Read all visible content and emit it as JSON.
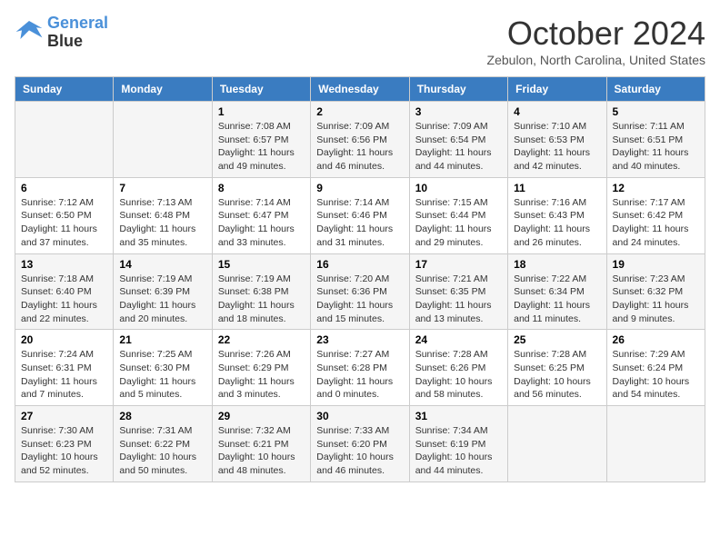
{
  "logo": {
    "line1": "General",
    "line2": "Blue"
  },
  "title": "October 2024",
  "location": "Zebulon, North Carolina, United States",
  "days_of_week": [
    "Sunday",
    "Monday",
    "Tuesday",
    "Wednesday",
    "Thursday",
    "Friday",
    "Saturday"
  ],
  "weeks": [
    [
      {
        "day": "",
        "info": ""
      },
      {
        "day": "",
        "info": ""
      },
      {
        "day": "1",
        "info": "Sunrise: 7:08 AM\nSunset: 6:57 PM\nDaylight: 11 hours and 49 minutes."
      },
      {
        "day": "2",
        "info": "Sunrise: 7:09 AM\nSunset: 6:56 PM\nDaylight: 11 hours and 46 minutes."
      },
      {
        "day": "3",
        "info": "Sunrise: 7:09 AM\nSunset: 6:54 PM\nDaylight: 11 hours and 44 minutes."
      },
      {
        "day": "4",
        "info": "Sunrise: 7:10 AM\nSunset: 6:53 PM\nDaylight: 11 hours and 42 minutes."
      },
      {
        "day": "5",
        "info": "Sunrise: 7:11 AM\nSunset: 6:51 PM\nDaylight: 11 hours and 40 minutes."
      }
    ],
    [
      {
        "day": "6",
        "info": "Sunrise: 7:12 AM\nSunset: 6:50 PM\nDaylight: 11 hours and 37 minutes."
      },
      {
        "day": "7",
        "info": "Sunrise: 7:13 AM\nSunset: 6:48 PM\nDaylight: 11 hours and 35 minutes."
      },
      {
        "day": "8",
        "info": "Sunrise: 7:14 AM\nSunset: 6:47 PM\nDaylight: 11 hours and 33 minutes."
      },
      {
        "day": "9",
        "info": "Sunrise: 7:14 AM\nSunset: 6:46 PM\nDaylight: 11 hours and 31 minutes."
      },
      {
        "day": "10",
        "info": "Sunrise: 7:15 AM\nSunset: 6:44 PM\nDaylight: 11 hours and 29 minutes."
      },
      {
        "day": "11",
        "info": "Sunrise: 7:16 AM\nSunset: 6:43 PM\nDaylight: 11 hours and 26 minutes."
      },
      {
        "day": "12",
        "info": "Sunrise: 7:17 AM\nSunset: 6:42 PM\nDaylight: 11 hours and 24 minutes."
      }
    ],
    [
      {
        "day": "13",
        "info": "Sunrise: 7:18 AM\nSunset: 6:40 PM\nDaylight: 11 hours and 22 minutes."
      },
      {
        "day": "14",
        "info": "Sunrise: 7:19 AM\nSunset: 6:39 PM\nDaylight: 11 hours and 20 minutes."
      },
      {
        "day": "15",
        "info": "Sunrise: 7:19 AM\nSunset: 6:38 PM\nDaylight: 11 hours and 18 minutes."
      },
      {
        "day": "16",
        "info": "Sunrise: 7:20 AM\nSunset: 6:36 PM\nDaylight: 11 hours and 15 minutes."
      },
      {
        "day": "17",
        "info": "Sunrise: 7:21 AM\nSunset: 6:35 PM\nDaylight: 11 hours and 13 minutes."
      },
      {
        "day": "18",
        "info": "Sunrise: 7:22 AM\nSunset: 6:34 PM\nDaylight: 11 hours and 11 minutes."
      },
      {
        "day": "19",
        "info": "Sunrise: 7:23 AM\nSunset: 6:32 PM\nDaylight: 11 hours and 9 minutes."
      }
    ],
    [
      {
        "day": "20",
        "info": "Sunrise: 7:24 AM\nSunset: 6:31 PM\nDaylight: 11 hours and 7 minutes."
      },
      {
        "day": "21",
        "info": "Sunrise: 7:25 AM\nSunset: 6:30 PM\nDaylight: 11 hours and 5 minutes."
      },
      {
        "day": "22",
        "info": "Sunrise: 7:26 AM\nSunset: 6:29 PM\nDaylight: 11 hours and 3 minutes."
      },
      {
        "day": "23",
        "info": "Sunrise: 7:27 AM\nSunset: 6:28 PM\nDaylight: 11 hours and 0 minutes."
      },
      {
        "day": "24",
        "info": "Sunrise: 7:28 AM\nSunset: 6:26 PM\nDaylight: 10 hours and 58 minutes."
      },
      {
        "day": "25",
        "info": "Sunrise: 7:28 AM\nSunset: 6:25 PM\nDaylight: 10 hours and 56 minutes."
      },
      {
        "day": "26",
        "info": "Sunrise: 7:29 AM\nSunset: 6:24 PM\nDaylight: 10 hours and 54 minutes."
      }
    ],
    [
      {
        "day": "27",
        "info": "Sunrise: 7:30 AM\nSunset: 6:23 PM\nDaylight: 10 hours and 52 minutes."
      },
      {
        "day": "28",
        "info": "Sunrise: 7:31 AM\nSunset: 6:22 PM\nDaylight: 10 hours and 50 minutes."
      },
      {
        "day": "29",
        "info": "Sunrise: 7:32 AM\nSunset: 6:21 PM\nDaylight: 10 hours and 48 minutes."
      },
      {
        "day": "30",
        "info": "Sunrise: 7:33 AM\nSunset: 6:20 PM\nDaylight: 10 hours and 46 minutes."
      },
      {
        "day": "31",
        "info": "Sunrise: 7:34 AM\nSunset: 6:19 PM\nDaylight: 10 hours and 44 minutes."
      },
      {
        "day": "",
        "info": ""
      },
      {
        "day": "",
        "info": ""
      }
    ]
  ]
}
